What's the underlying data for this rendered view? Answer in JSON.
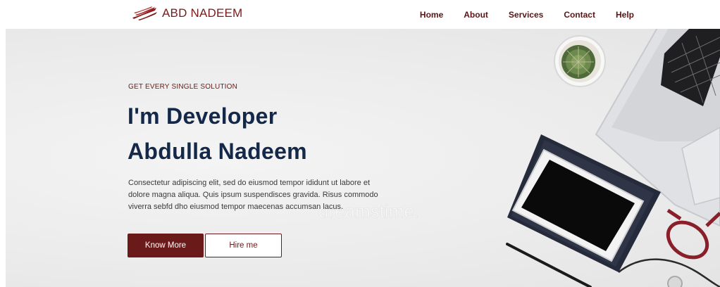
{
  "brand": {
    "name": "ABD NADEEM",
    "icon": "wing-logo-icon",
    "color": "#7a1b1b"
  },
  "nav": {
    "items": [
      {
        "label": "Home"
      },
      {
        "label": "About"
      },
      {
        "label": "Services"
      },
      {
        "label": "Contact"
      },
      {
        "label": "Help"
      }
    ]
  },
  "hero": {
    "eyebrow": "GET EVERY SINGLE SOLUTION",
    "title_line1": "I'm Developer",
    "title_line2": "Abdulla Nadeem",
    "description_lines": [
      "Consectetur adipiscing elit, sed do eiusmod tempor ididunt ut labore et",
      "dolore magna aliqua. Quis ipsum suspendisces gravida. Risus commodo",
      "viverra sebfd dho eiusmod tempor maecenas accumsan lacus."
    ],
    "primary_button": "Know More",
    "secondary_button": "Hire me",
    "watermark": "dreamstime."
  },
  "colors": {
    "accent": "#6b1a1a",
    "heading": "#14284a",
    "body_text": "#3a3a3a"
  }
}
